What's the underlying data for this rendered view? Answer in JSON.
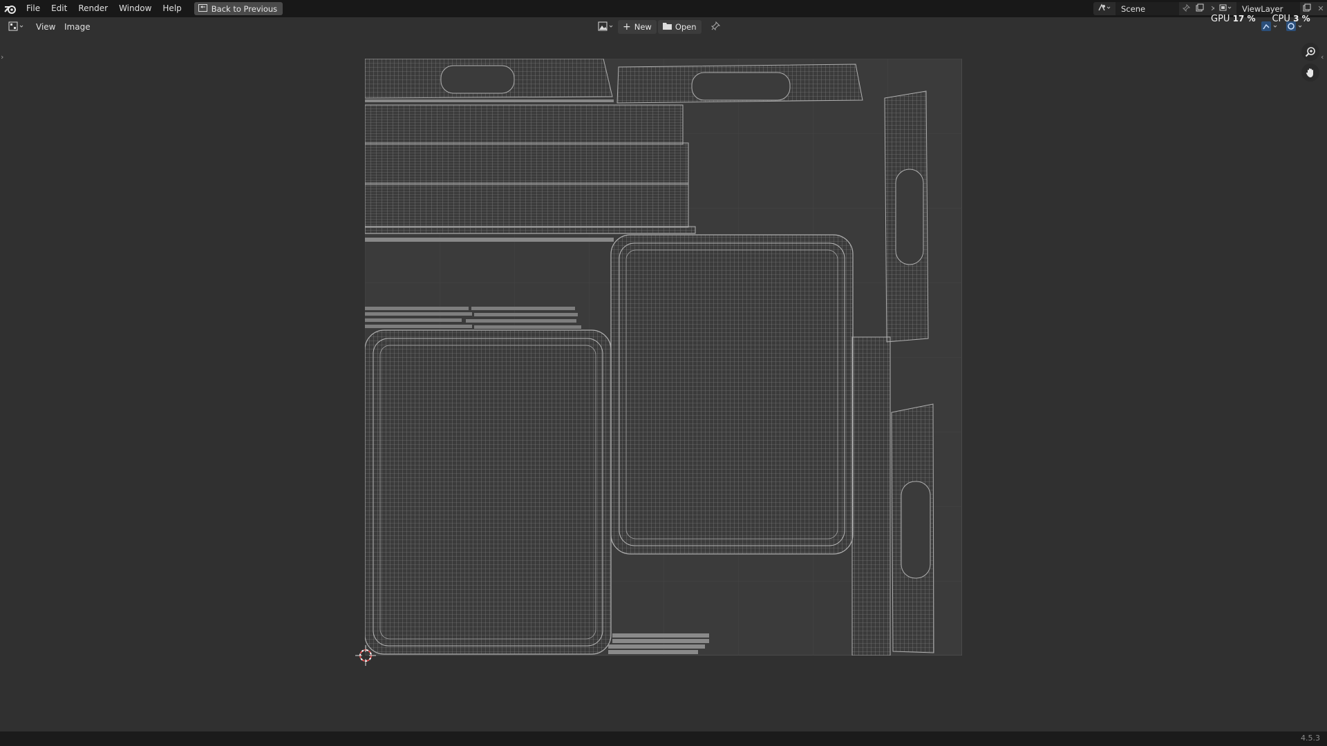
{
  "topbar": {
    "menus": [
      "File",
      "Edit",
      "Render",
      "Window",
      "Help"
    ],
    "back_button": "Back to Previous",
    "scene_label": "Scene",
    "view_layer_label": "ViewLayer"
  },
  "header": {
    "menus": [
      "View",
      "Image"
    ],
    "new_label": "New",
    "open_label": "Open"
  },
  "stats": {
    "gpu_label": "GPU",
    "gpu_value": "17 %",
    "cpu_label": "CPU",
    "cpu_value": "3 %"
  },
  "status": {
    "version": "4.5.3"
  },
  "icons": {
    "logo": "blender-logo-icon",
    "back": "back-to-previous-icon",
    "editor": "image-editor-type-icon",
    "new": "plus-icon",
    "open": "folder-icon",
    "pin": "pin-icon",
    "zoom": "zoom-icon",
    "pan": "hand-icon",
    "cursor": "cursor-3d-icon"
  },
  "colors": {
    "topbar_bg": "#181818",
    "editor_bg": "#303030",
    "uv_bg": "#3b3b3b",
    "uv_wire": "#9a9a9a"
  }
}
